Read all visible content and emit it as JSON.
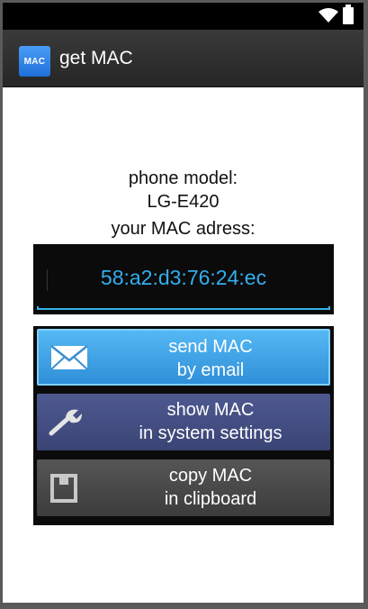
{
  "statusbar": {
    "icons": [
      "wifi-icon",
      "battery-icon"
    ]
  },
  "actionbar": {
    "icon_text": "MAC",
    "title": "get MAC"
  },
  "info": {
    "model_label": "phone model:",
    "model_value": "LG-E420",
    "mac_label": "your MAC adress:",
    "mac_value": "58:a2:d3:76:24:ec"
  },
  "buttons": [
    {
      "line1": "send MAC",
      "line2": "by email",
      "icon": "envelope-icon"
    },
    {
      "line1": "show MAC",
      "line2": "in system settings",
      "icon": "wrench-icon"
    },
    {
      "line1": "copy MAC",
      "line2": "in clipboard",
      "icon": "clipboard-icon"
    }
  ],
  "colors": {
    "accent": "#33b5e5",
    "email_button": "#3fa2e3",
    "settings_button": "#454f82",
    "copy_button": "#4a4a4a"
  }
}
